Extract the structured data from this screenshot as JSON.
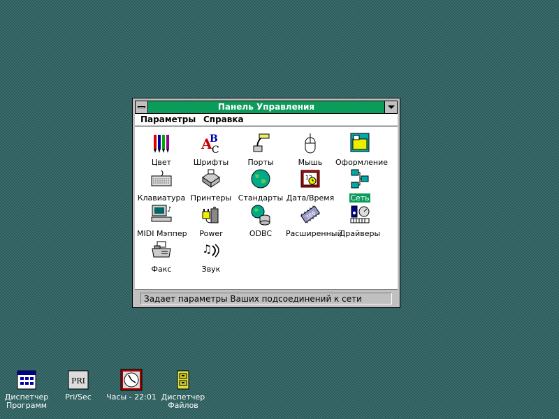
{
  "window": {
    "title": "Панель Управления",
    "menu": [
      {
        "label": "Параметры"
      },
      {
        "label": "Справка"
      }
    ],
    "icons": [
      {
        "label": "Цвет",
        "icon": "color-icon"
      },
      {
        "label": "Шрифты",
        "icon": "fonts-icon"
      },
      {
        "label": "Порты",
        "icon": "ports-icon"
      },
      {
        "label": "Мышь",
        "icon": "mouse-icon"
      },
      {
        "label": "Оформление",
        "icon": "desktop-icon"
      },
      {
        "label": "Клавиатура",
        "icon": "keyboard-icon"
      },
      {
        "label": "Принтеры",
        "icon": "printer-icon"
      },
      {
        "label": "Стандарты",
        "icon": "globe-icon"
      },
      {
        "label": "Дата/Время",
        "icon": "calendar-clock-icon"
      },
      {
        "label": "Сеть",
        "icon": "network-icon",
        "selected": true
      },
      {
        "label": "MIDI Мэппер",
        "icon": "midi-computer-icon"
      },
      {
        "label": "Power",
        "icon": "battery-plug-icon"
      },
      {
        "label": "ODBC",
        "icon": "database-globe-icon"
      },
      {
        "label": "Расширенный",
        "icon": "chip-386-icon"
      },
      {
        "label": "Драйверы",
        "icon": "drivers-icon"
      },
      {
        "label": "Факс",
        "icon": "fax-icon"
      },
      {
        "label": "Звук",
        "icon": "sound-icon"
      }
    ],
    "status": "Задает параметры Ваших подсоединений к сети"
  },
  "desktop": {
    "icons": [
      {
        "label_line1": "Диспетчер",
        "label_line2": "Программ",
        "icon": "program-manager-icon"
      },
      {
        "label_line1": "Pri/Sec",
        "label_line2": "",
        "icon": "pri-icon",
        "icon_text": "PRI"
      },
      {
        "label_line1": "Часы - 22:01",
        "label_line2": "",
        "icon": "clock-icon"
      },
      {
        "label_line1": "Диспетчер",
        "label_line2": "Файлов",
        "icon": "file-manager-icon"
      }
    ]
  },
  "colors": {
    "titlebar": "#0b9b5a",
    "selection": "#0b9b5a",
    "desktop": "#3a6e6e"
  }
}
